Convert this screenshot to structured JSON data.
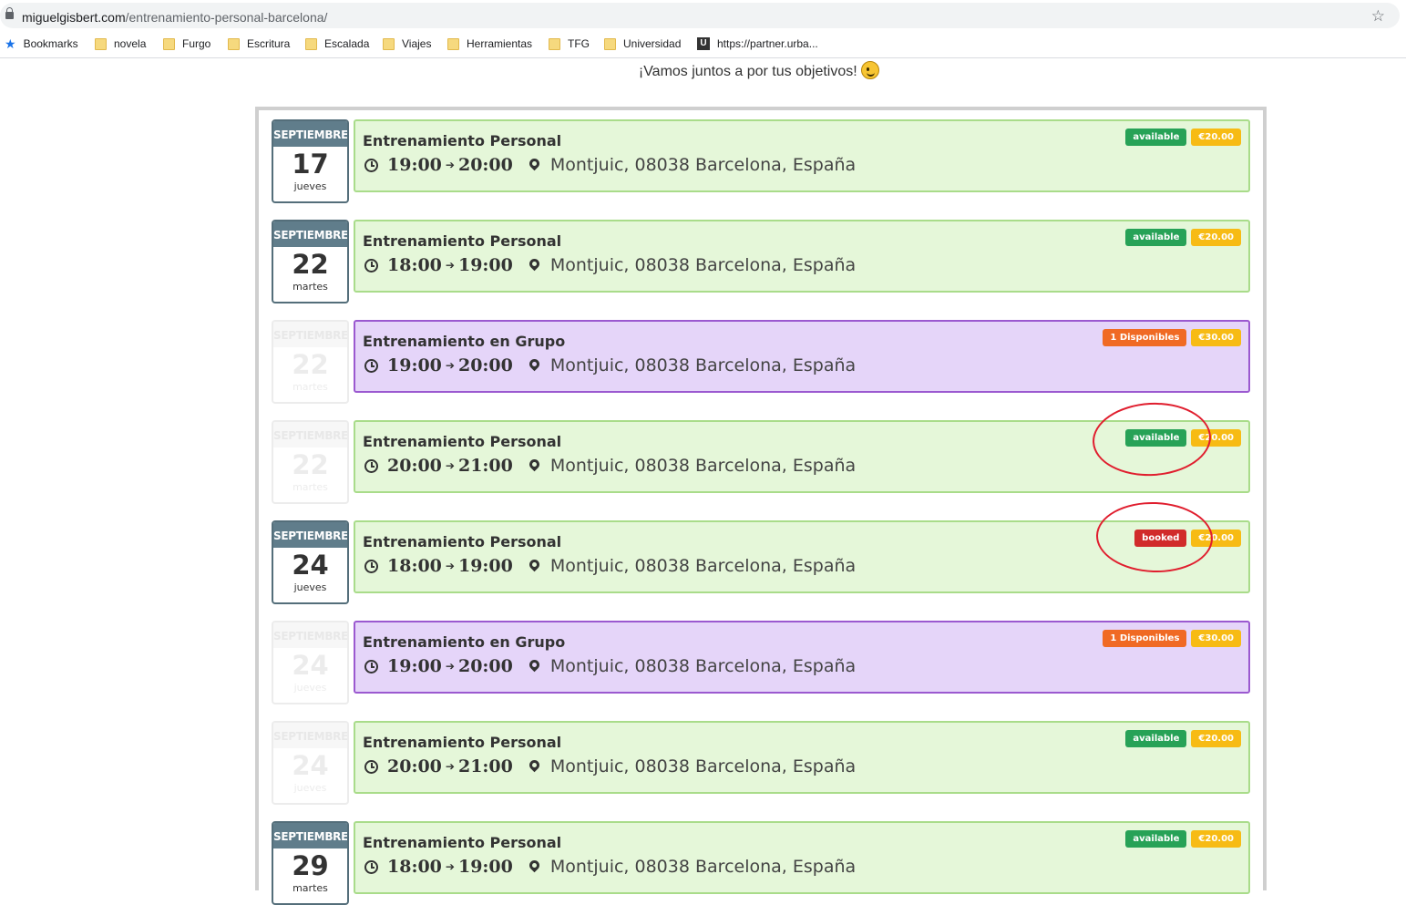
{
  "browser": {
    "url_host": "miguelgisbert.com",
    "url_path": "/entrenamiento-personal-barcelona/",
    "bookmarks": [
      "Bookmarks",
      "novela",
      "Furgo",
      "Escritura",
      "Escalada",
      "Viajes",
      "Herramientas",
      "TFG",
      "Universidad",
      "https://partner.urba..."
    ]
  },
  "page": {
    "tagline": "¡Vamos juntos a por tus objetivos!"
  },
  "events": [
    {
      "month": "SEPTIEMBRE",
      "day": "17",
      "weekday": "jueves",
      "faded": false,
      "type": "personal",
      "title": "Entrenamiento Personal",
      "start": "19:00",
      "end": "20:00",
      "location": "Montjuic, 08038 Barcelona, España",
      "status": "available",
      "price": "€20.00"
    },
    {
      "month": "SEPTIEMBRE",
      "day": "22",
      "weekday": "martes",
      "faded": false,
      "type": "personal",
      "title": "Entrenamiento Personal",
      "start": "18:00",
      "end": "19:00",
      "location": "Montjuic, 08038 Barcelona, España",
      "status": "available",
      "price": "€20.00"
    },
    {
      "month": "SEPTIEMBRE",
      "day": "22",
      "weekday": "martes",
      "faded": true,
      "type": "group",
      "title": "Entrenamiento en Grupo",
      "start": "19:00",
      "end": "20:00",
      "location": "Montjuic, 08038 Barcelona, España",
      "status": "1 Disponibles",
      "price": "€30.00"
    },
    {
      "month": "SEPTIEMBRE",
      "day": "22",
      "weekday": "martes",
      "faded": true,
      "type": "personal",
      "title": "Entrenamiento Personal",
      "start": "20:00",
      "end": "21:00",
      "location": "Montjuic, 08038 Barcelona, España",
      "status": "available",
      "price": "€20.00"
    },
    {
      "month": "SEPTIEMBRE",
      "day": "24",
      "weekday": "jueves",
      "faded": false,
      "type": "personal",
      "title": "Entrenamiento Personal",
      "start": "18:00",
      "end": "19:00",
      "location": "Montjuic, 08038 Barcelona, España",
      "status": "booked",
      "price": "€20.00"
    },
    {
      "month": "SEPTIEMBRE",
      "day": "24",
      "weekday": "jueves",
      "faded": true,
      "type": "group",
      "title": "Entrenamiento en Grupo",
      "start": "19:00",
      "end": "20:00",
      "location": "Montjuic, 08038 Barcelona, España",
      "status": "1 Disponibles",
      "price": "€30.00"
    },
    {
      "month": "SEPTIEMBRE",
      "day": "24",
      "weekday": "jueves",
      "faded": true,
      "type": "personal",
      "title": "Entrenamiento Personal",
      "start": "20:00",
      "end": "21:00",
      "location": "Montjuic, 08038 Barcelona, España",
      "status": "available",
      "price": "€20.00"
    },
    {
      "month": "SEPTIEMBRE",
      "day": "29",
      "weekday": "martes",
      "faded": false,
      "type": "personal",
      "title": "Entrenamiento Personal",
      "start": "18:00",
      "end": "19:00",
      "location": "Montjuic, 08038 Barcelona, España",
      "status": "available",
      "price": "€20.00"
    }
  ],
  "colors": {
    "available": "#27a257",
    "booked": "#d12b2b",
    "disponibles": "#f06a24",
    "price": "#f7bb14",
    "annotation": "#e01e2e"
  }
}
